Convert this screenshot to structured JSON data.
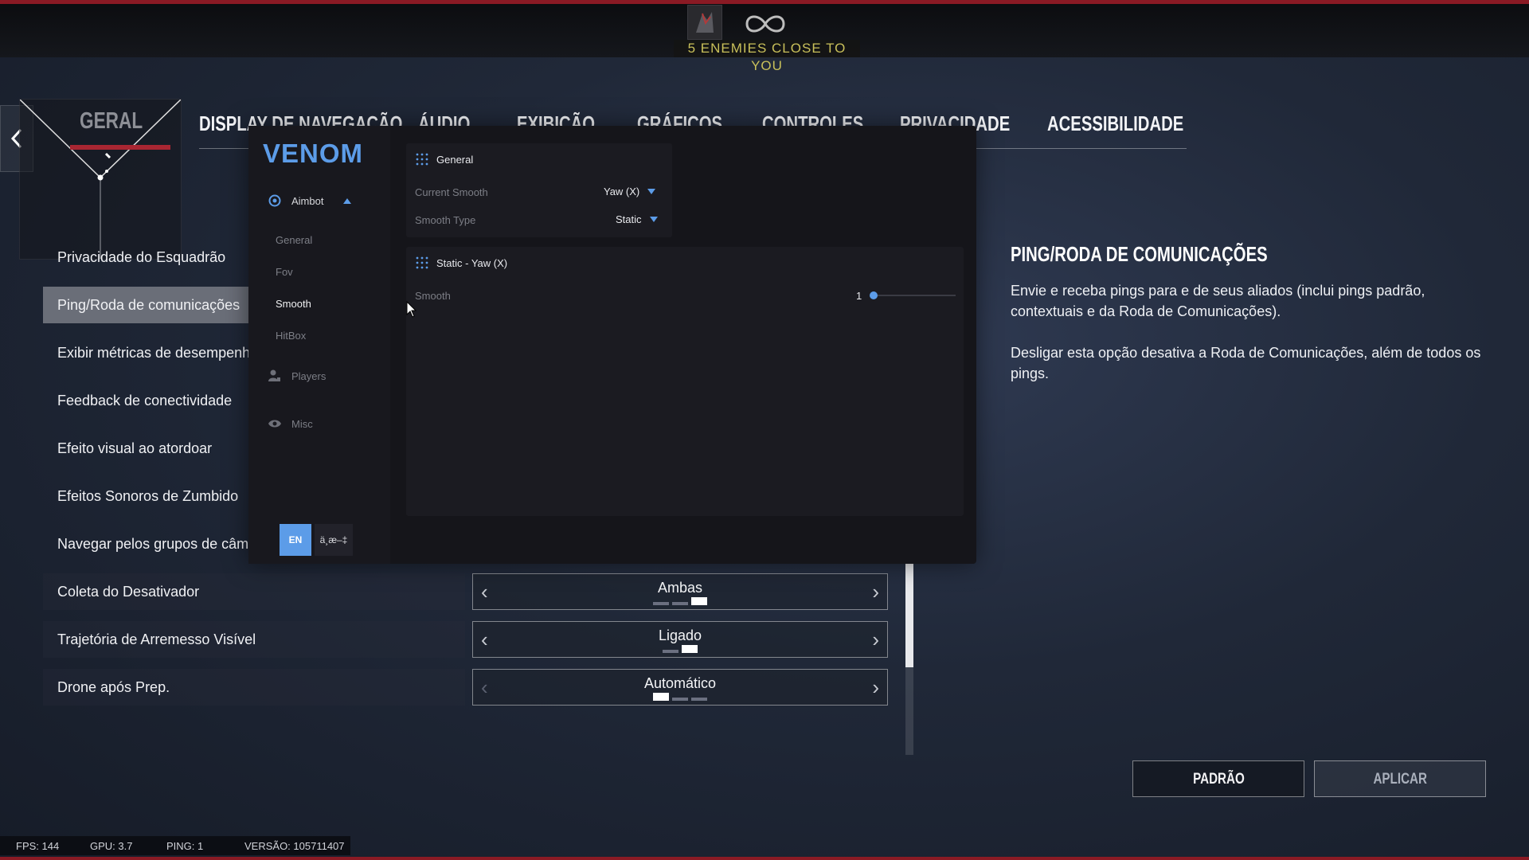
{
  "hud": {
    "enemies_text": "5 ENEMIES CLOSE TO YOU",
    "infinity_icon": "infinity-icon"
  },
  "tabs": [
    {
      "label": "GERAL"
    },
    {
      "label": "DISPLAY DE NAVEGAÇÃO"
    },
    {
      "label": "ÁUDIO"
    },
    {
      "label": "EXIBIÇÃO"
    },
    {
      "label": "GRÁFICOS"
    },
    {
      "label": "CONTROLES"
    },
    {
      "label": "PRIVACIDADE"
    },
    {
      "label": "ACESSIBILIDADE"
    }
  ],
  "settings": [
    {
      "label": "Privacidade do Esquadrão"
    },
    {
      "label": "Ping/Roda de comunicações"
    },
    {
      "label": "Exibir métricas de desempenho"
    },
    {
      "label": "Feedback de conectividade"
    },
    {
      "label": "Efeito visual ao atordoar"
    },
    {
      "label": "Efeitos Sonoros de Zumbido"
    },
    {
      "label": "Navegar pelos grupos de câmeras"
    },
    {
      "label": "Coleta do Desativador",
      "value": "Ambas"
    },
    {
      "label": "Trajetória de Arremesso Visível",
      "value": "Ligado"
    },
    {
      "label": "Drone após Prep.",
      "value": "Automático"
    }
  ],
  "description": {
    "title": "PING/RODA DE COMUNICAÇÕES",
    "p1": "Envie e receba pings para e de seus aliados (inclui pings padrão, contextuais e da Roda de Comunicações).",
    "p2": "Desligar esta opção desativa a Roda de Comunicações, além de todos os pings."
  },
  "buttons": {
    "default": "PADRÃO",
    "apply": "APLICAR"
  },
  "status": {
    "fps": "FPS: 144",
    "gpu": "GPU: 3.7",
    "ping": "PING: 1",
    "version": "VERSÃO: 105711407"
  },
  "venom": {
    "title": "VENOM",
    "nav": {
      "aimbot": "Aimbot",
      "players": "Players",
      "misc": "Misc"
    },
    "aimbot_sub": [
      "General",
      "Fov",
      "Smooth",
      "HitBox"
    ],
    "general_panel": {
      "title": "General",
      "rows": [
        {
          "label": "Current Smooth",
          "value": "Yaw (X)"
        },
        {
          "label": "Smooth Type",
          "value": "Static"
        }
      ]
    },
    "static_panel": {
      "title": "Static - Yaw (X)",
      "smooth_label": "Smooth",
      "smooth_value": "1"
    },
    "lang": {
      "en": "EN",
      "other": "ä¸­æ–‡"
    }
  },
  "colors": {
    "accent": "#5c9ce8",
    "brand_red": "#a82632"
  }
}
